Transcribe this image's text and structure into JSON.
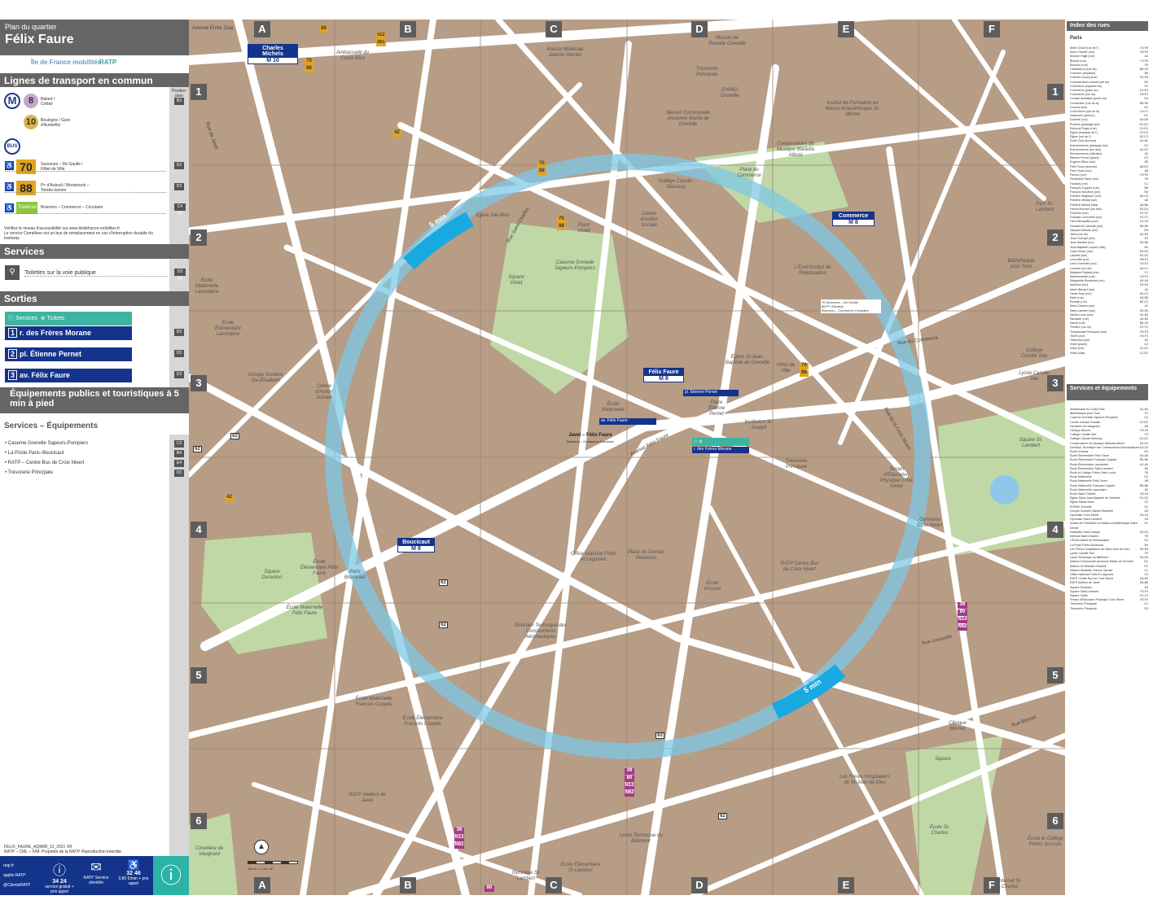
{
  "header": {
    "subtitle": "Plan du quartier",
    "title": "Félix Faure"
  },
  "logos": {
    "idf": "Île de France mobilités",
    "ratp": "RATP"
  },
  "transport": {
    "heading": "Lignes de transport en commun",
    "subhead": "Position plan",
    "metro": [
      {
        "line": "8",
        "dest": "Balard / Créteil",
        "ref": "B3"
      },
      {
        "line": "10",
        "dest": "Boulogne / Gare d'Austerlitz",
        "ref": ""
      }
    ],
    "bus_title": "BUS",
    "buses": [
      {
        "line": "70",
        "dest": "Suresnes – De Gaulle / Hôtel de Ville",
        "ref": "D3"
      },
      {
        "line": "88",
        "dest": "Pᵗᵉ d'Auteuil / Montsouris – Tombe-Issoire",
        "ref": "D3"
      },
      {
        "line": "Traverse",
        "dest": "Brancion – Commerce – Circulaire",
        "ref": "C4 D3"
      }
    ],
    "note1": "Vérifiez le niveau d'accessibilité sur www.iledefrance-mobilites.fr",
    "note2": "Le service Caméléon est un bus de remplacement en cas d'interruption durable du tramway"
  },
  "services": {
    "heading": "Services",
    "toilets": "Toilettes sur la voie publique",
    "toilets_ref": "D3 D6"
  },
  "exits": {
    "heading": "Sorties",
    "services_label": "Services",
    "tickets_label": "Tickets",
    "items": [
      {
        "num": "1",
        "label": "r. des Frères Morane",
        "ref": "D3"
      },
      {
        "num": "2",
        "label": "pl. Étienne Pernet",
        "ref": "D3"
      },
      {
        "num": "3",
        "label": "av. Félix Faure",
        "ref": "D3"
      }
    ]
  },
  "equip": {
    "heading": "Équipements publics et touristiques à 5 min à pied",
    "sub": "Services – Équipements",
    "items": [
      {
        "label": "• Caserne Grenelle Sapeurs-Pompiers",
        "ref": "C2"
      },
      {
        "label": "• La Poste Paris–Boucicaut",
        "ref": "B4"
      },
      {
        "label": "• RATP – Centre Bus de Croix Nivert",
        "ref": "E4"
      },
      {
        "label": "• Trésorerie Principale",
        "ref": "D3"
      }
    ]
  },
  "footer": {
    "code": "FELIX_FAURE_AQM08_12_2021 XR",
    "rights": "RATP – CML – IVM: Propriété de la RATP. Reproduction interdite",
    "links": [
      "ratp.fr",
      "applis RATP",
      "@ClientsRATP"
    ],
    "phone1": "34 24",
    "phone1_sub": "service gratuit + prix appel",
    "service_client": "RATP Service clientèle",
    "phone2": "32 46",
    "phone2_sub": "0,80 €/min + prix appel"
  },
  "map": {
    "columns": [
      "A",
      "B",
      "C",
      "D",
      "E",
      "F"
    ],
    "rows": [
      "1",
      "2",
      "3",
      "4",
      "5",
      "6"
    ],
    "stations": [
      {
        "name": "Charles Michels",
        "lines": "M 10"
      },
      {
        "name": "Commerce",
        "lines": "M 8"
      },
      {
        "name": "Félix Faure",
        "lines": "M 8"
      },
      {
        "name": "Boucicaut",
        "lines": "M 8"
      }
    ],
    "walk_label": "5 min",
    "exits_on_map": [
      "pl. Étienne Pernet",
      "av. Félix Faure",
      "r. des Frères Morane"
    ],
    "bus_stop_label": "Javel – Félix Faure",
    "bus_stop_sub": "Brancion – Commerce Circulaire",
    "stop_lines": [
      "70 Suresnes – De Gaulle",
      "88 Pᵗᵉ d'Auteuil",
      "Brancion – Commerce Circulaire"
    ],
    "places": [
      "Maison Médicale Jeanne Garnier",
      "Ambassade du Costa Rica",
      "Maison de Retraite Grenelle",
      "Trésorerie Principale",
      "EHPAD Grenelle",
      "Maison Communale Ancienne Mairie de Grenelle",
      "Institut de Formation en Masso-Kinésithérapie St-Michel",
      "Conservatoire de Musique Marietta Alboni",
      "Église Ste-Nino",
      "Collège Claude-Debussy",
      "Place du Commerce",
      "Place Violet",
      "Centre d'Action Sociale",
      "Caserne Grenelle Sapeurs-Pompiers",
      "Square Violet",
      "L'Éveil Institut de Rééducation",
      "Bibliothèque pour Tous",
      "Parc St-Lambert",
      "École Maternelle Lacordaire",
      "École Élémentaire Lacordaire",
      "Groupe Scolaire Ste-Élisabeth",
      "Centre d'Action Sociale",
      "Église St-Jean-Baptiste de Grenelle",
      "Hôtel de Ville",
      "Collège Camille Sée",
      "Lycée Camille Sée",
      "École Maternelle",
      "Place Étienne Pernet",
      "Institution St-Joseph",
      "Trésorerie Principale",
      "Terrain d'Éducation Physique Croix Nivert",
      "Square St-Lambert",
      "Gymnase Croix-Nivert",
      "Square Duranton",
      "École Élémentaire Félix Faure",
      "École Maternelle Félix Faure",
      "Paris Boucicaut",
      "Office National Fruits et Légumes",
      "Place du Comtat Venaissin",
      "RATP Centre Bus de Croix Nivert",
      "École d'Assas",
      "Direction Technique des Constructions Aéronautiques",
      "École Maternelle François Coppée",
      "École Élémentaire François Coppée",
      "Clinique Blomet",
      "Square",
      "Les Frères Hospitaliers de St-Jean de Dieu",
      "RATP Ateliers de Javel",
      "Lycée Technique du Bâtiment",
      "École Élémentaire St-Lambert",
      "Gymnase St-Lambert",
      "École St-Charles",
      "École et Collège Privés St-Louis",
      "Internat St-Charles",
      "Cimetière de Vaugirard"
    ],
    "streets": [
      "Avenue Émile Zola",
      "Rue du Commerce",
      "Rue Lecourbe",
      "Rue de la Croix Nivert",
      "Avenue Félix Faure",
      "Rue de Javel",
      "Rue Saint-Charles",
      "Rue Blomet"
    ],
    "bus_badges": [
      "70",
      "88",
      "42",
      "62",
      "39",
      "80",
      "N13",
      "N62",
      "N12",
      "N61"
    ],
    "scale": "100 m = 1 min 30"
  },
  "index": {
    "streets_heading": "Index des rues",
    "city": "Paris",
    "streets": [
      [
        "Abbé Groult (rue de l')",
        "E3-F6"
      ],
      [
        "Alain Chartier (rue)",
        "E6-F6"
      ],
      [
        "Antoine Hajje (rue)",
        "A1"
      ],
      [
        "Blomet (rue)",
        "F3-F5"
      ],
      [
        "Bouchut (rue)",
        "F5"
      ],
      [
        "Casablanca (rue de)",
        "B6-C6"
      ],
      [
        "Chandon (impasse)",
        "B5"
      ],
      [
        "Charles Lecocq (rue)",
        "E4-E5"
      ],
      [
        "Commandant Léandri (rue du)",
        "D6"
      ],
      [
        "Commerce (impasse du)",
        "E1"
      ],
      [
        "Commerce (place du)",
        "D1-E2"
      ],
      [
        "Commerce (rue du)",
        "D3-F1"
      ],
      [
        "Comtat Venaissin (place du)",
        "D4"
      ],
      [
        "Convention (rue de la)",
        "B5-E6"
      ],
      [
        "Cournot (rue)",
        "D3"
      ],
      [
        "Croix Nivert (rue de la)",
        "C4-F1"
      ],
      [
        "Delecourt (avenue)",
        "D1"
      ],
      [
        "Dutertre (rue)",
        "A4-D6"
      ],
      [
        "Écoliers (passage des)",
        "D1-D2"
      ],
      [
        "Edmond Roger (rue)",
        "C1-D1"
      ],
      [
        "Église (impasse de l')",
        "C3-D3"
      ],
      [
        "Église (rue de l')",
        "B1-C3"
      ],
      [
        "Émile Zola (avenue)",
        "A1-B1"
      ],
      [
        "Entrepreneurs (passage des)",
        "D2"
      ],
      [
        "Entrepreneurs (rue des)",
        "A1-E3"
      ],
      [
        "Entrepreneurs (villa des)",
        "A3"
      ],
      [
        "Étienne Pernet (place)",
        "D3"
      ],
      [
        "Eugène Millon (rue)",
        "E6"
      ],
      [
        "Félix Faure (avenue)",
        "A5-D3"
      ],
      [
        "Félix Faure (rue)",
        "A6"
      ],
      [
        "Fenoux (rue)",
        "F5-F6"
      ],
      [
        "Ferdinand Fabre (rue)",
        "F6"
      ],
      [
        "Fondary (rue)",
        "C1"
      ],
      [
        "François Coppée (rue)",
        "B5"
      ],
      [
        "François Mouthon (rue)",
        "D6"
      ],
      [
        "Frédéric Magisson (rue)",
        "B4-C3"
      ],
      [
        "Frédéric Mistral (rue)",
        "A6"
      ],
      [
        "Frédéric Mistral (villa)",
        "A6-B6"
      ],
      [
        "Frères Morane (rue des)",
        "D3-D4"
      ],
      [
        "Gramme (rue)",
        "E1-F2"
      ],
      [
        "Gustave Larroumet (rue)",
        "E1-F1"
      ],
      [
        "Henri Bocquillon (rue)",
        "C4-C5"
      ],
      [
        "Houdart de Lamotte (rue)",
        "B4-B5"
      ],
      [
        "Jacques Mawas (rue)",
        "D6"
      ],
      [
        "Javel (rue de)",
        "A2-E6"
      ],
      [
        "Jean Formigé (rue)",
        "E4"
      ],
      [
        "Jean Maridor (rue)",
        "A5-B6"
      ],
      [
        "Jean-Baptiste Luquet (villa)",
        "B1"
      ],
      [
        "Jules Simon (rue)",
        "D4-D5"
      ],
      [
        "Lakanal (rue)",
        "E2-E3"
      ],
      [
        "Lecourbe (rue)",
        "B6-F4"
      ],
      [
        "Léon Lhermitte (rue)",
        "E3-F3"
      ],
      [
        "Lourmel (rue de)",
        "A4-C1"
      ],
      [
        "Madame Rolland (rue)",
        "C1"
      ],
      [
        "Mademoiselle (rue)",
        "E3-F3"
      ],
      [
        "Marguerite Boucicaut (rue)",
        "A3-A4"
      ],
      [
        "Marinoni (rue)",
        "E3-E4"
      ],
      [
        "Marie Bénard (rue)",
        "A4"
      ],
      [
        "Oscar Roty (rue)",
        "A5-C4"
      ],
      [
        "Pétel (rue)",
        "A5-B5"
      ],
      [
        "Rouelle (rue)",
        "B2-C2"
      ],
      [
        "Saint-Charles (rue)",
        "A1"
      ],
      [
        "Saint-Lambert (rue)",
        "E6-E6"
      ],
      [
        "Sainte-Lucie (rue)",
        "A2-B3"
      ],
      [
        "Sarasate (rue)",
        "A4-B3"
      ],
      [
        "Sauvé (rue)",
        "B6-C6"
      ],
      [
        "Théâtre (rue du)",
        "E1-F1"
      ],
      [
        "Théophraste Renaudot (rue)",
        "E5-F5"
      ],
      [
        "Thiers (rue)",
        "E3-F3"
      ],
      [
        "Tisserand (rue)",
        "A3"
      ],
      [
        "Violet (place)",
        "C2"
      ],
      [
        "Violet (rue)",
        "C2-D1"
      ],
      [
        "Violet (villa)",
        "C2-D2"
      ]
    ],
    "services_heading": "Services et équipements",
    "services": [
      [
        "Ambassade du Costa Rica",
        "A1-B1"
      ],
      [
        "Bibliothèque pour Tous",
        "F2"
      ],
      [
        "Caserne Grenelle Sapeurs-Pompiers",
        "C2"
      ],
      [
        "Centre d'Action Sociale",
        "C2-D2"
      ],
      [
        "Cimetière de Vaugirard",
        "A6"
      ],
      [
        "Clinique Blomet",
        "F5-F6"
      ],
      [
        "Collège Camille Sée",
        "F3"
      ],
      [
        "Collège Claude Debussy",
        "D1-D2"
      ],
      [
        "Conservatoire de Musique Marietta Alboni",
        "D1-E2"
      ],
      [
        "Direction Technique des Constructions Aéronautiques",
        "C4-C5"
      ],
      [
        "École d'Assas",
        "D4"
      ],
      [
        "École Élémentaire Félix Faure",
        "A4-A5"
      ],
      [
        "École Élémentaire François Coppée",
        "B5-B6"
      ],
      [
        "École Élémentaire Lacordaire",
        "A2-A3"
      ],
      [
        "École Élémentaire Saint-Lambert",
        "E6"
      ],
      [
        "École et Collège Privés Saint-Louis",
        "F6"
      ],
      [
        "École Maternelle",
        "D3"
      ],
      [
        "École Maternelle Félix Faure",
        "A5"
      ],
      [
        "École Maternelle François Coppée",
        "B5-B6"
      ],
      [
        "École Maternelle Lacordaire",
        "A2"
      ],
      [
        "École Saint-Charles",
        "E5-F6"
      ],
      [
        "Église Saint-Jean-Baptiste de Grenelle",
        "E1-E3"
      ],
      [
        "Église Sainte-Nino",
        "C2"
      ],
      [
        "EHPAD Grenelle",
        "D1"
      ],
      [
        "Groupe Scolaire Sainte-Élisabeth",
        "A3"
      ],
      [
        "Gymnase Croix-Nivert",
        "E4-F4"
      ],
      [
        "Gymnase Saint-Lambert",
        "C6"
      ],
      [
        "Institut de Formation en Masso-Kinésithérapie Saint-Michel",
        "E1"
      ],
      [
        "Institution Saint-Joseph",
        "D3-E3"
      ],
      [
        "Internat Saint-Charles",
        "F6"
      ],
      [
        "L'Éveil Institut de Rééducation",
        "E2"
      ],
      [
        "La Poste Paris–Boucicaut",
        "B4"
      ],
      [
        "Les Frères Hospitaliers de Saint-Jean de Dieu",
        "E5-E6"
      ],
      [
        "Lycée Camille Sée",
        "F3"
      ],
      [
        "Lycée Technique du Bâtiment",
        "C6-D6"
      ],
      [
        "Maison Communale Ancienne Mairie de Grenelle",
        "D1"
      ],
      [
        "Maison de Retraite Grenelle",
        "D1"
      ],
      [
        "Maison Médicale Jeanne Garnier",
        "C1"
      ],
      [
        "Office National Fruits et Légumes",
        "C4"
      ],
      [
        "RATP Centre Bus de Croix Nivert",
        "D4-E5"
      ],
      [
        "RATP Ateliers de Javel",
        "A5-B6"
      ],
      [
        "Square Duranton",
        "A4"
      ],
      [
        "Square Saint-Lambert",
        "F3-F4"
      ],
      [
        "Square Violet",
        "C2-C3"
      ],
      [
        "Terrain d'Éducation Physique Croix Nivert",
        "E3-F4"
      ],
      [
        "Trésorerie Principale",
        "D1"
      ],
      [
        "Trésorerie Principale",
        "D3"
      ]
    ]
  }
}
